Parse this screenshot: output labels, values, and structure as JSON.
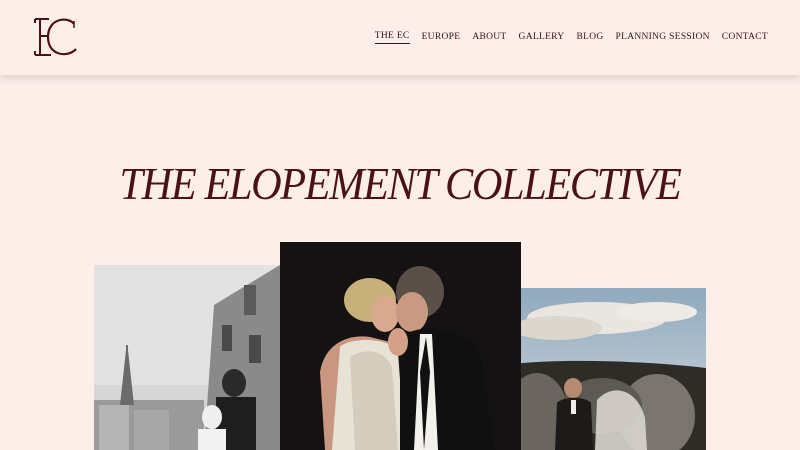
{
  "header": {
    "logo_text": "EC",
    "nav": [
      {
        "label": "THE EC",
        "active": true
      },
      {
        "label": "EUROPE",
        "active": false
      },
      {
        "label": "ABOUT",
        "active": false
      },
      {
        "label": "GALLERY",
        "active": false
      },
      {
        "label": "BLOG",
        "active": false
      },
      {
        "label": "PLANNING SESSION",
        "active": false
      },
      {
        "label": "CONTACT",
        "active": false
      }
    ]
  },
  "hero": {
    "title": "THE ELOPEMENT COLLECTIVE"
  },
  "colors": {
    "background": "#fcefea",
    "brand": "#4a1218"
  }
}
